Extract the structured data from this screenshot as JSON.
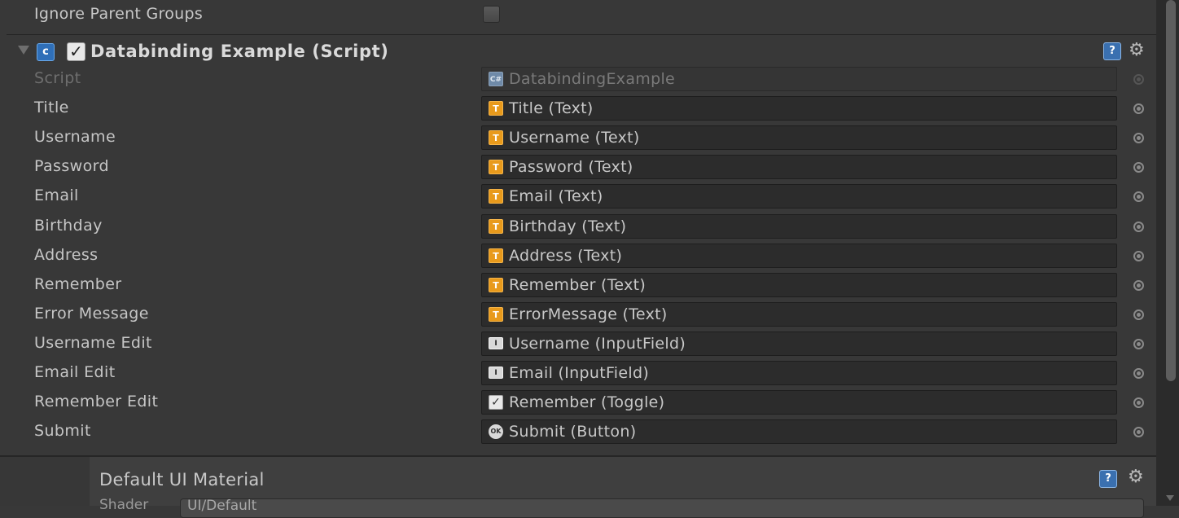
{
  "ignore_parent_groups": {
    "label": "Ignore Parent Groups",
    "checked": false
  },
  "component": {
    "title": "Databinding Example (Script)",
    "enabled": true,
    "icon": "csharp-script-icon",
    "help_icon": "help-icon",
    "settings_icon": "gear-icon",
    "fields": [
      {
        "label": "Script",
        "value": "DatabindingExample",
        "icon": "script-icon",
        "disabled": true
      },
      {
        "label": "Title",
        "value": "Title (Text)",
        "icon": "text-component-icon"
      },
      {
        "label": "Username",
        "value": "Username (Text)",
        "icon": "text-component-icon"
      },
      {
        "label": "Password",
        "value": "Password (Text)",
        "icon": "text-component-icon"
      },
      {
        "label": "Email",
        "value": "Email (Text)",
        "icon": "text-component-icon"
      },
      {
        "label": "Birthday",
        "value": "Birthday (Text)",
        "icon": "text-component-icon"
      },
      {
        "label": "Address",
        "value": "Address (Text)",
        "icon": "text-component-icon"
      },
      {
        "label": "Remember",
        "value": "Remember (Text)",
        "icon": "text-component-icon"
      },
      {
        "label": "Error Message",
        "value": "ErrorMessage (Text)",
        "icon": "text-component-icon"
      },
      {
        "label": "Username Edit",
        "value": "Username (InputField)",
        "icon": "inputfield-component-icon"
      },
      {
        "label": "Email Edit",
        "value": "Email (InputField)",
        "icon": "inputfield-component-icon"
      },
      {
        "label": "Remember Edit",
        "value": "Remember (Toggle)",
        "icon": "toggle-component-icon"
      },
      {
        "label": "Submit",
        "value": "Submit (Button)",
        "icon": "button-component-icon"
      }
    ]
  },
  "material": {
    "title": "Default UI Material",
    "shader_label": "Shader",
    "shader_value": "UI/Default"
  },
  "colors": {
    "background": "#383838",
    "field_bg": "#2c2c2c",
    "text": "#c4c4c4",
    "text_component_icon": "#e89a1c",
    "help_icon": "#3a70b0"
  }
}
